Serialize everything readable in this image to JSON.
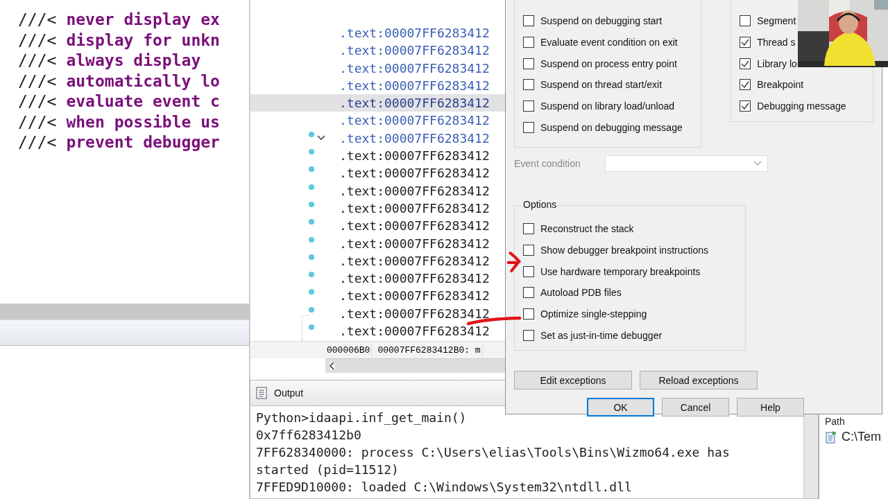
{
  "code_lines": [
    {
      "marker": "///<",
      "comment": "never display ex"
    },
    {
      "marker": "///<",
      "comment": "display for unkn"
    },
    {
      "marker": "///<",
      "comment": "always display"
    },
    {
      "marker": "///<",
      "comment": "automatically lo"
    },
    {
      "marker": "///<",
      "comment": "evaluate event c"
    },
    {
      "marker": "///<",
      "comment": "when possible us"
    },
    {
      "marker": "///<",
      "comment": "prevent debugger"
    }
  ],
  "disassembly": {
    "rows": [
      {
        "text": ".text:00007FF6283412",
        "color": "#3a5fb5",
        "selected": false,
        "collapse_toggle": false,
        "traced": false
      },
      {
        "text": ".text:00007FF6283412",
        "color": "#3a5fb5",
        "selected": false,
        "collapse_toggle": false,
        "traced": false
      },
      {
        "text": ".text:00007FF6283412",
        "color": "#3a5fb5",
        "selected": false,
        "collapse_toggle": false,
        "traced": false
      },
      {
        "text": ".text:00007FF6283412",
        "color": "#3a5fb5",
        "selected": false,
        "collapse_toggle": false,
        "traced": false
      },
      {
        "text": ".text:00007FF6283412",
        "color": "#2a3f8f",
        "selected": true,
        "collapse_toggle": false,
        "traced": false
      },
      {
        "text": ".text:00007FF6283412",
        "color": "#3a5fb5",
        "selected": false,
        "collapse_toggle": false,
        "traced": false
      },
      {
        "text": ".text:00007FF6283412",
        "color": "#3a5fb5",
        "selected": false,
        "collapse_toggle": true,
        "traced": true
      },
      {
        "text": ".text:00007FF6283412",
        "color": "#222222",
        "selected": false,
        "collapse_toggle": false,
        "traced": true
      },
      {
        "text": ".text:00007FF6283412",
        "color": "#222222",
        "selected": false,
        "collapse_toggle": false,
        "traced": true
      },
      {
        "text": ".text:00007FF6283412",
        "color": "#222222",
        "selected": false,
        "collapse_toggle": false,
        "traced": true
      },
      {
        "text": ".text:00007FF6283412",
        "color": "#222222",
        "selected": false,
        "collapse_toggle": false,
        "traced": true
      },
      {
        "text": ".text:00007FF6283412",
        "color": "#222222",
        "selected": false,
        "collapse_toggle": false,
        "traced": true
      },
      {
        "text": ".text:00007FF6283412",
        "color": "#222222",
        "selected": false,
        "collapse_toggle": false,
        "traced": true
      },
      {
        "text": ".text:00007FF6283412",
        "color": "#222222",
        "selected": false,
        "collapse_toggle": false,
        "traced": true
      },
      {
        "text": ".text:00007FF6283412",
        "color": "#222222",
        "selected": false,
        "collapse_toggle": false,
        "traced": true
      },
      {
        "text": ".text:00007FF6283412",
        "color": "#222222",
        "selected": false,
        "collapse_toggle": false,
        "traced": true
      },
      {
        "text": ".text:00007FF6283412",
        "color": "#222222",
        "selected": false,
        "collapse_toggle": false,
        "traced": true
      },
      {
        "text": ".text:00007FF6283412",
        "color": "#222222",
        "selected": false,
        "collapse_toggle": false,
        "traced": true
      }
    ],
    "status_offset": "000006B0",
    "status_address": "00007FF6283412B0: m"
  },
  "output": {
    "title": "Output",
    "lines": [
      "Python>idaapi.inf_get_main()",
      "0x7ff6283412b0",
      "7FF628340000: process C:\\Users\\elias\\Tools\\Bins\\Wizmo64.exe has",
      "started (pid=11512)",
      "7FFED9D10000: loaded C:\\Windows\\System32\\ntdll.dll"
    ]
  },
  "side_panel": {
    "column": "Path",
    "item": "C:\\Tem"
  },
  "dialog": {
    "events": [
      {
        "label": "Suspend on debugging start",
        "checked": false
      },
      {
        "label": "Evaluate event condition on exit",
        "checked": false
      },
      {
        "label": "Suspend on process entry point",
        "checked": false
      },
      {
        "label": "Suspend on thread start/exit",
        "checked": false
      },
      {
        "label": "Suspend on library load/unload",
        "checked": false
      },
      {
        "label": "Suspend on debugging message",
        "checked": false
      }
    ],
    "logging": [
      {
        "label": "Segment",
        "checked": false
      },
      {
        "label": "Thread s",
        "checked": true
      },
      {
        "label": "Library lo",
        "checked": true
      },
      {
        "label": "Breakpoint",
        "checked": true
      },
      {
        "label": "Debugging message",
        "checked": true
      }
    ],
    "event_condition": {
      "label": "Event condition",
      "disabled": true
    },
    "options_title": "Options",
    "options": [
      {
        "label": "Reconstruct the stack",
        "checked": false
      },
      {
        "label": "Show debugger breakpoint instructions",
        "checked": false
      },
      {
        "label": "Use hardware temporary breakpoints",
        "checked": false
      },
      {
        "label": "Autoload PDB files",
        "checked": false
      },
      {
        "label": "Optimize single-stepping",
        "checked": false
      },
      {
        "label": "Set as just-in-time debugger",
        "checked": false
      }
    ],
    "exception_buttons": [
      "Edit exceptions",
      "Reload exceptions"
    ],
    "buttons": [
      {
        "label": "OK",
        "default": true
      },
      {
        "label": "Cancel",
        "default": false
      },
      {
        "label": "Help",
        "default": false
      }
    ]
  }
}
